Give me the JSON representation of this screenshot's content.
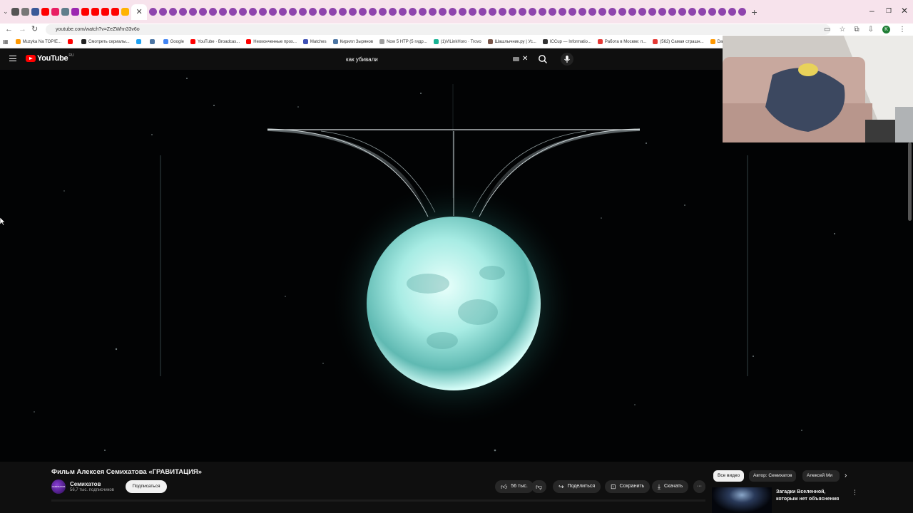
{
  "browser": {
    "tab_colors": [
      "#555555",
      "#777777",
      "#3b5998",
      "#ff0000",
      "#e91e63",
      "#607d8b",
      "#9c27b0",
      "#ff0000",
      "#ff0000",
      "#ff0000",
      "#ff0000",
      "#ffb300"
    ],
    "tab_repeat_color": "#8e44ad",
    "active_tab_close": "✕",
    "new_tab": "+",
    "url": "youtube.com/watch?v=ZeZWhn33v6o",
    "bookmarks": [
      {
        "label": "Muzyka Na TOP!E...",
        "color": "#ff9800"
      },
      {
        "label": "",
        "color": "#ff0000"
      },
      {
        "label": "Смотреть сериалы...",
        "color": "#222222"
      },
      {
        "label": "",
        "color": "#1da1f2"
      },
      {
        "label": "",
        "color": "#4c75a3"
      },
      {
        "label": "Google",
        "color": "#4285f4"
      },
      {
        "label": "YouTube · Broadcas...",
        "color": "#ff0000"
      },
      {
        "label": "Неоконченные прох...",
        "color": "#ff0000"
      },
      {
        "label": "Matches",
        "color": "#3f51b5"
      },
      {
        "label": "Кирилл Зырянов",
        "color": "#4c75a3"
      },
      {
        "label": "Now 5 HTP (5 гидр...",
        "color": "#9e9e9e"
      },
      {
        "label": "(1)VlLinkHoro · Trovo",
        "color": "#19b394"
      },
      {
        "label": "Шашлычник.ру | Ус...",
        "color": "#795548"
      },
      {
        "label": "ICCup — Informatio...",
        "color": "#333333"
      },
      {
        "label": "Работа в Москве: п...",
        "color": "#e53935"
      },
      {
        "label": "(562) Самая страшн...",
        "color": "#e53935"
      },
      {
        "label": "Dat",
        "color": "#ff9800"
      }
    ]
  },
  "youtube": {
    "logo_text": "YouTube",
    "logo_region": "RU",
    "search_value": "как убивали"
  },
  "video": {
    "title": "Фильм Алексея Семихатова «ГРАВИТАЦИЯ»",
    "channel": "Семихатов",
    "channel_avatar_text": "СЕМИХАТОВ",
    "subscribers": "56,7 тыс. подписчиков",
    "subscribe_label": "Подписаться",
    "likes": "56 тыс.",
    "share_label": "Поделиться",
    "save_label": "Сохранить",
    "download_label": "Скачать",
    "more": "···"
  },
  "chips": [
    "Все видео",
    "Автор: Семихатов",
    "Алексей Ми"
  ],
  "recommendation": {
    "title": "Загадки Вселенной, которым нет объяснения"
  }
}
